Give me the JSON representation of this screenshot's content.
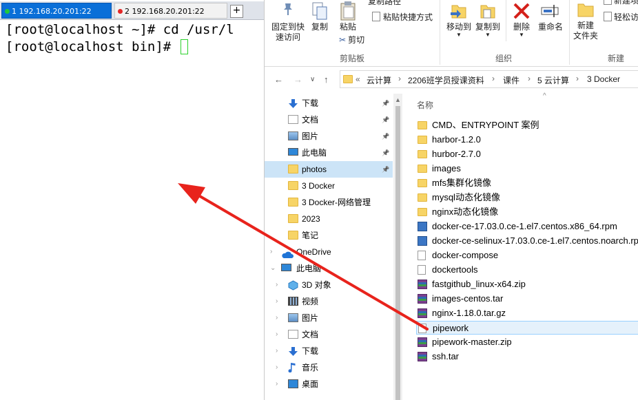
{
  "terminal": {
    "tabs": [
      {
        "number": "1",
        "host": "192.168.20.201:22",
        "status_color": "#22c93a",
        "active": true
      },
      {
        "number": "2",
        "host": "192.168.20.201:22",
        "status_color": "#e32727",
        "active": false
      }
    ],
    "add_tab": "+",
    "lines": [
      "[root@localhost ~]# cd /usr/l",
      "[root@localhost bin]# "
    ]
  },
  "ribbon": {
    "clipboard": {
      "pin_label": "固定到快\n速访问",
      "copy_label": "复制",
      "paste_label": "粘贴",
      "copy_path_label": "复制路径",
      "paste_shortcut_label": "粘贴快捷方式",
      "cut_label": "剪切",
      "group_label": "剪贴板"
    },
    "organize": {
      "move_to_label": "移动到",
      "copy_to_label": "复制到",
      "delete_label": "删除",
      "rename_label": "重命名",
      "group_label": "组织"
    },
    "new": {
      "new_folder_label": "新建\n文件夹",
      "new_item_label": "新建项",
      "easy_access_label": "轻松访",
      "group_label": "新建"
    }
  },
  "address": {
    "back": "←",
    "forward": "→",
    "recent": "∨",
    "up": "↑",
    "overflow": "«",
    "breadcrumbs": [
      "云计算",
      "2206班学员授课资料",
      "课件",
      "5 云计算",
      "3 Docker"
    ]
  },
  "nav": {
    "items": [
      {
        "label": "下载",
        "icon": "download-arrow-icon",
        "pinned": true,
        "level": 1
      },
      {
        "label": "文档",
        "icon": "document-icon",
        "pinned": true,
        "level": 1
      },
      {
        "label": "图片",
        "icon": "pictures-icon",
        "pinned": true,
        "level": 1
      },
      {
        "label": "此电脑",
        "icon": "computer-icon",
        "pinned": true,
        "level": 1
      },
      {
        "label": "photos",
        "icon": "folder-icon",
        "pinned": true,
        "level": 1,
        "selected": true
      },
      {
        "label": "3 Docker",
        "icon": "folder-icon",
        "pinned": false,
        "level": 1
      },
      {
        "label": "3 Docker-网络管理",
        "icon": "folder-icon",
        "pinned": false,
        "level": 1
      },
      {
        "label": "2023",
        "icon": "folder-icon",
        "pinned": false,
        "level": 1
      },
      {
        "label": "笔记",
        "icon": "folder-icon",
        "pinned": false,
        "level": 1
      },
      {
        "label": "OneDrive",
        "icon": "cloud-icon",
        "pinned": false,
        "level": 0
      },
      {
        "label": "此电脑",
        "icon": "computer-icon",
        "pinned": false,
        "level": 0,
        "expanded": true
      },
      {
        "label": "3D 对象",
        "icon": "3d-objects-icon",
        "pinned": false,
        "level": 1
      },
      {
        "label": "视频",
        "icon": "video-icon",
        "pinned": false,
        "level": 1
      },
      {
        "label": "图片",
        "icon": "pictures-icon",
        "pinned": false,
        "level": 1
      },
      {
        "label": "文档",
        "icon": "document-icon",
        "pinned": false,
        "level": 1
      },
      {
        "label": "下载",
        "icon": "download-arrow-icon",
        "pinned": false,
        "level": 1
      },
      {
        "label": "音乐",
        "icon": "music-icon",
        "pinned": false,
        "level": 1
      },
      {
        "label": "桌面",
        "icon": "desktop-icon",
        "pinned": false,
        "level": 1
      }
    ]
  },
  "files": {
    "column_header": "名称",
    "items": [
      {
        "name": "CMD、ENTRYPOINT 案例",
        "type": "folder"
      },
      {
        "name": "harbor-1.2.0",
        "type": "folder"
      },
      {
        "name": "hurbor-2.7.0",
        "type": "folder"
      },
      {
        "name": "images",
        "type": "folder"
      },
      {
        "name": "mfs集群化镜像",
        "type": "folder"
      },
      {
        "name": "mysql动态化镜像",
        "type": "folder"
      },
      {
        "name": "nginx动态化镜像",
        "type": "folder"
      },
      {
        "name": "docker-ce-17.03.0.ce-1.el7.centos.x86_64.rpm",
        "type": "rpm"
      },
      {
        "name": "docker-ce-selinux-17.03.0.ce-1.el7.centos.noarch.rpm",
        "type": "rpm"
      },
      {
        "name": "docker-compose",
        "type": "file"
      },
      {
        "name": "dockertools",
        "type": "file"
      },
      {
        "name": "fastgithub_linux-x64.zip",
        "type": "archive"
      },
      {
        "name": "images-centos.tar",
        "type": "archive"
      },
      {
        "name": "nginx-1.18.0.tar.gz",
        "type": "archive"
      },
      {
        "name": "pipework",
        "type": "file",
        "selected": true
      },
      {
        "name": "pipework-master.zip",
        "type": "archive"
      },
      {
        "name": "ssh.tar",
        "type": "archive"
      }
    ]
  },
  "colors": {
    "annotation_arrow": "#e8231c",
    "selection": "#cce4f7",
    "folder": "#f7d466",
    "terminal_tab_active": "#0a6fd8"
  }
}
